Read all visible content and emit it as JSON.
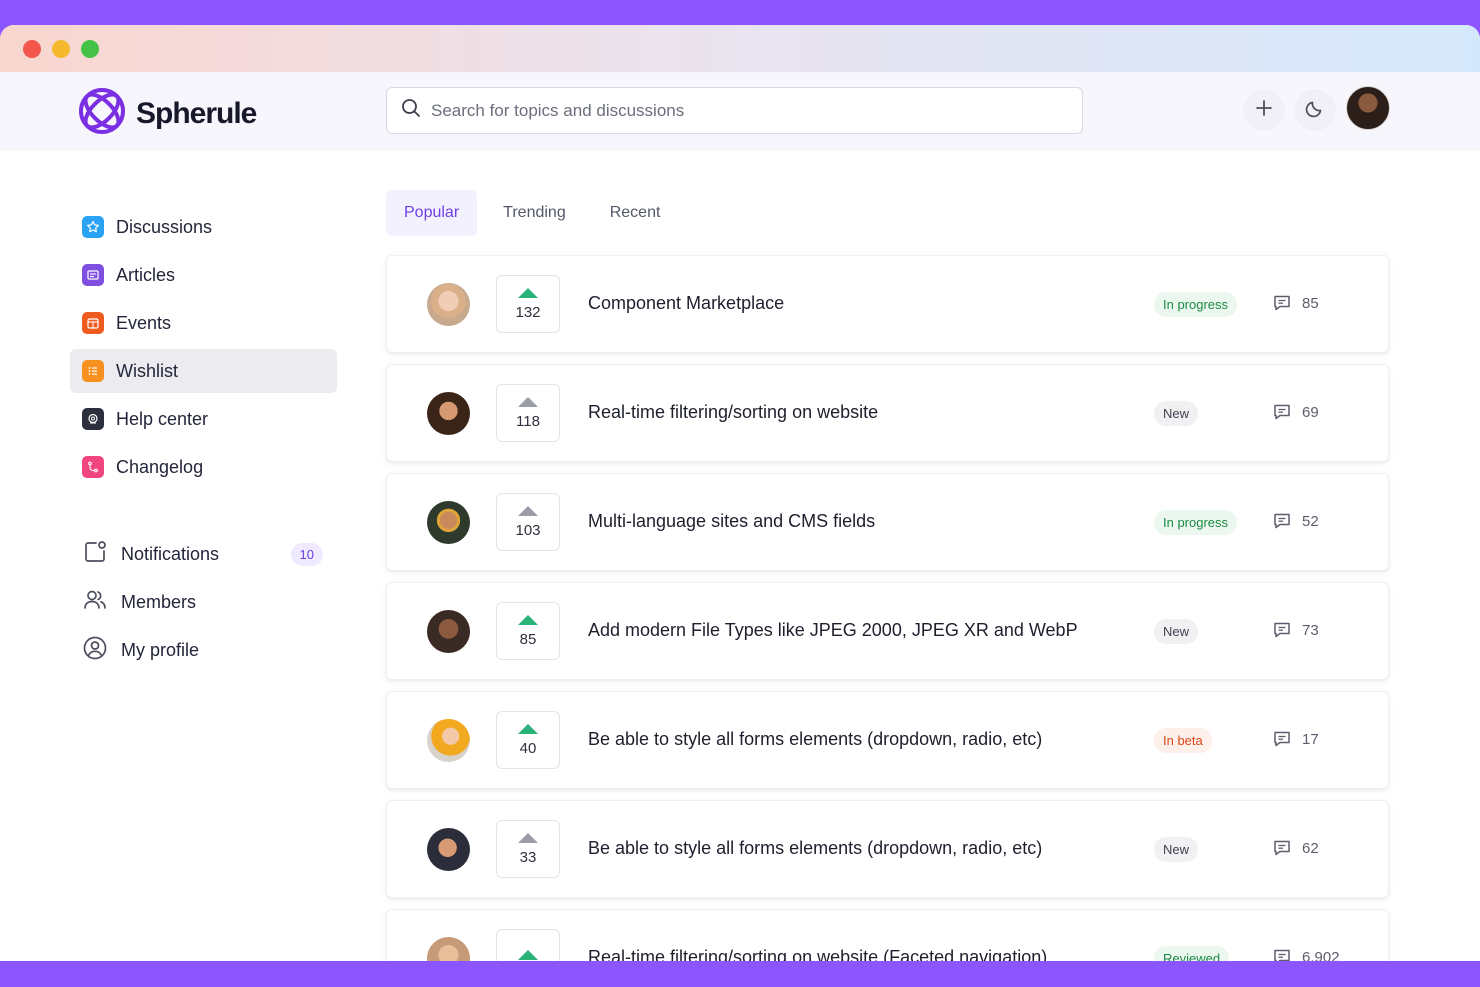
{
  "app": {
    "name": "Spherule"
  },
  "search": {
    "placeholder": "Search for topics and discussions"
  },
  "header": {
    "add_icon": "plus-icon",
    "theme_icon": "moon-icon"
  },
  "sidebar": {
    "items": [
      {
        "label": "Discussions",
        "icon": "star-icon",
        "color": "#2aa3f5"
      },
      {
        "label": "Articles",
        "icon": "newspaper-icon",
        "color": "#7e4fe0"
      },
      {
        "label": "Events",
        "icon": "calendar-icon",
        "color": "#ef5a1e"
      },
      {
        "label": "Wishlist",
        "icon": "list-icon",
        "color": "#f6901e",
        "active": true
      },
      {
        "label": "Help center",
        "icon": "support-icon",
        "color": "#2b2f3d"
      },
      {
        "label": "Changelog",
        "icon": "branch-icon",
        "color": "#f0457d"
      }
    ],
    "secondary": [
      {
        "label": "Notifications",
        "icon": "notification-icon",
        "count": "10"
      },
      {
        "label": "Members",
        "icon": "users-icon"
      },
      {
        "label": "My profile",
        "icon": "user-circle-icon"
      }
    ]
  },
  "tabs": [
    {
      "label": "Popular",
      "active": true
    },
    {
      "label": "Trending"
    },
    {
      "label": "Recent"
    }
  ],
  "posts": [
    {
      "votes": "132",
      "voted": true,
      "title": "Component Marketplace",
      "status": "In progress",
      "status_color": "green",
      "comments": "85"
    },
    {
      "votes": "118",
      "voted": false,
      "title": "Real-time filtering/sorting on website",
      "status": "New",
      "status_color": "gray",
      "comments": "69"
    },
    {
      "votes": "103",
      "voted": false,
      "title": "Multi-language sites and CMS fields",
      "status": "In progress",
      "status_color": "green",
      "comments": "52"
    },
    {
      "votes": "85",
      "voted": true,
      "title": "Add modern File Types like JPEG 2000, JPEG XR and WebP",
      "status": "New",
      "status_color": "gray",
      "comments": "73"
    },
    {
      "votes": "40",
      "voted": true,
      "title": "Be able to style all forms elements (dropdown, radio, etc)",
      "status": "In beta",
      "status_color": "orange",
      "comments": "17"
    },
    {
      "votes": "33",
      "voted": false,
      "title": "Be able to style all forms elements (dropdown, radio, etc)",
      "status": "New",
      "status_color": "gray",
      "comments": "62"
    },
    {
      "votes": "",
      "voted": true,
      "title": "Real-time filtering/sorting on website (Faceted navigation)",
      "status": "Reviewed",
      "status_color": "green",
      "comments": "6,902"
    }
  ]
}
